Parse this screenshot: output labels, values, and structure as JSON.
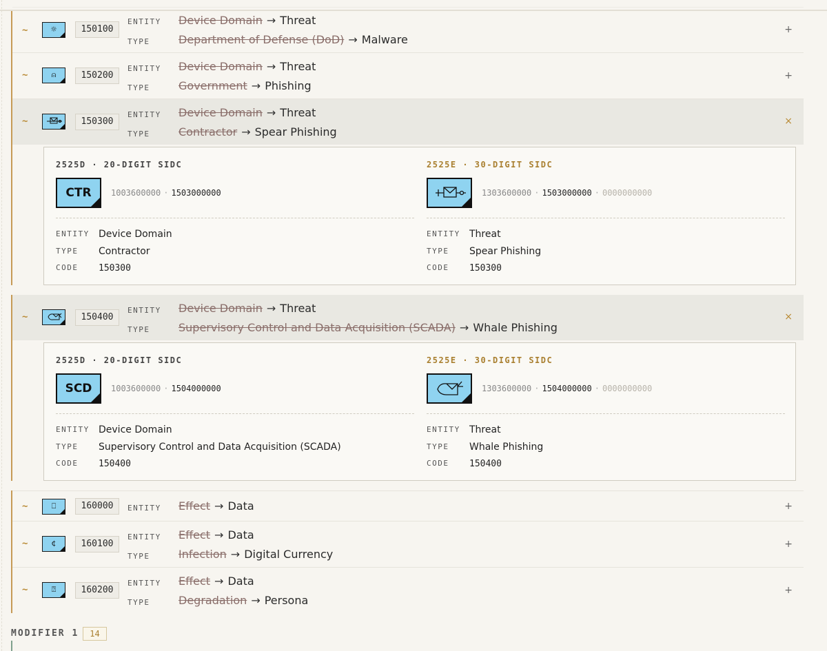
{
  "labels": {
    "entity": "ENTITY",
    "type": "TYPE",
    "code": "CODE",
    "arrow": "→",
    "plus": "+",
    "close": "×"
  },
  "rows": [
    {
      "code": "150100",
      "entity_old": "Device Domain",
      "entity_new": "Threat",
      "type_old": "Department of Defense (DoD)",
      "type_new": "Malware",
      "icon": "bug-icon"
    },
    {
      "code": "150200",
      "entity_old": "Device Domain",
      "entity_new": "Threat",
      "type_old": "Government",
      "type_new": "Phishing",
      "icon": "hook-icon"
    },
    {
      "code": "150300",
      "entity_old": "Device Domain",
      "entity_new": "Threat",
      "type_old": "Contractor",
      "type_new": "Spear Phishing",
      "icon": "spear-envelope-icon"
    },
    {
      "code": "150400",
      "entity_old": "Device Domain",
      "entity_new": "Threat",
      "type_old": "Supervisory Control and Data Acquisition (SCADA)",
      "type_new": "Whale Phishing",
      "icon": "whale-envelope-icon"
    },
    {
      "code": "160000",
      "entity_old": "Effect",
      "entity_new": "Data",
      "icon": "document-icon"
    },
    {
      "code": "160100",
      "entity_old": "Effect",
      "entity_new": "Data",
      "type_old": "Infection",
      "type_new": "Digital Currency",
      "icon": "currency-icon"
    },
    {
      "code": "160200",
      "entity_old": "Effect",
      "entity_new": "Data",
      "type_old": "Degradation",
      "type_new": "Persona",
      "icon": "persona-icon"
    }
  ],
  "panels": [
    {
      "left": {
        "heading": "2525D · 20-DIGIT SIDC",
        "symbol_text": "CTR",
        "sidc_a": "1003600000",
        "sidc_b": "1503000000",
        "entity": "Device Domain",
        "type": "Contractor",
        "code": "150300"
      },
      "right": {
        "heading": "2525E · 30-DIGIT SIDC",
        "sidc_a": "1303600000",
        "sidc_b": "1503000000",
        "sidc_c": "0000000000",
        "entity": "Threat",
        "type": "Spear Phishing",
        "code": "150300"
      }
    },
    {
      "left": {
        "heading": "2525D · 20-DIGIT SIDC",
        "symbol_text": "SCD",
        "sidc_a": "1003600000",
        "sidc_b": "1504000000",
        "entity": "Device Domain",
        "type": "Supervisory Control and Data Acquisition (SCADA)",
        "code": "150400"
      },
      "right": {
        "heading": "2525E · 30-DIGIT SIDC",
        "sidc_a": "1303600000",
        "sidc_b": "1504000000",
        "sidc_c": "0000000000",
        "entity": "Threat",
        "type": "Whale Phishing",
        "code": "150400"
      }
    }
  ],
  "footer": {
    "label": "MODIFIER 1",
    "count": "14"
  },
  "colors": {
    "accent": "#b98a35",
    "symbol_fill": "#8fd3f0",
    "background": "#f7f5f0"
  },
  "tilde": "~"
}
